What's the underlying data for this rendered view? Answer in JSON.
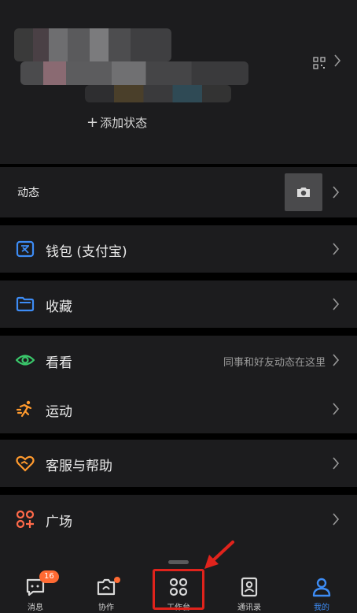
{
  "profile": {
    "add_status": "添加状态",
    "qr_icon": "qr-code-icon"
  },
  "moments": {
    "label": "动态",
    "camera_icon": "camera-icon"
  },
  "menu": [
    {
      "label": "钱包 (支付宝)",
      "icon": "wallet-icon",
      "color": "#3d8cf5"
    },
    {
      "label": "收藏",
      "icon": "folder-icon",
      "color": "#3d8cf5"
    },
    {
      "label": "看看",
      "icon": "eye-icon",
      "color": "#3ac86b",
      "hint": "同事和好友动态在这里"
    },
    {
      "label": "运动",
      "icon": "run-icon",
      "color": "#ff9a2e"
    },
    {
      "label": "客服与帮助",
      "icon": "heart-icon",
      "color": "#ff9a2e"
    },
    {
      "label": "广场",
      "icon": "plaza-icon",
      "color": "#ff6a4a"
    }
  ],
  "tabs": [
    {
      "label": "消息",
      "icon": "message-icon",
      "badge": "16"
    },
    {
      "label": "协作",
      "icon": "collab-icon"
    },
    {
      "label": "工作台",
      "icon": "workbench-icon"
    },
    {
      "label": "通讯录",
      "icon": "contacts-icon"
    },
    {
      "label": "我的",
      "icon": "profile-icon",
      "active": true
    }
  ],
  "colors": {
    "accent": "#3d8cf5",
    "badge": "#ff6a33",
    "highlight": "#e0231c",
    "bg": "#1c1c1e"
  }
}
